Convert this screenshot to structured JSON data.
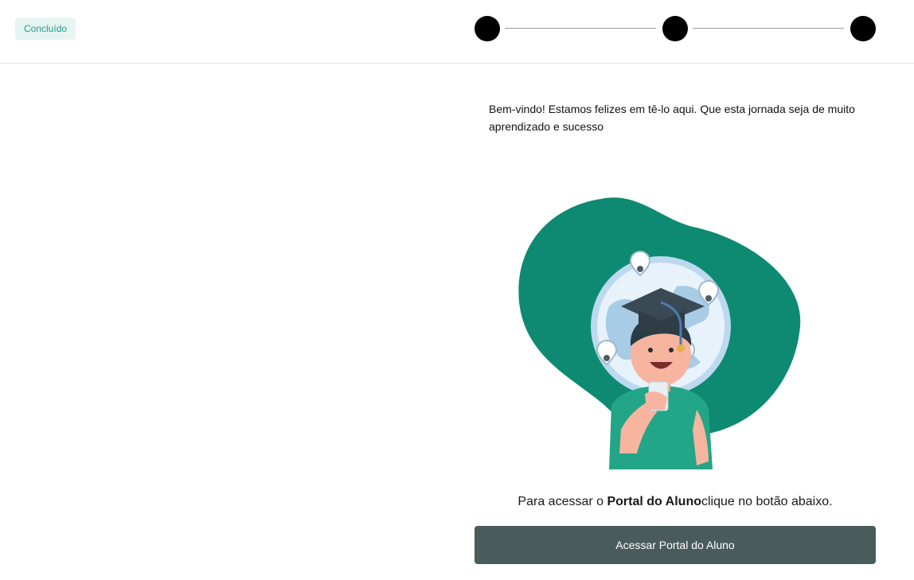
{
  "header": {
    "status_badge": "Concluído",
    "stepper": {
      "steps": 3
    }
  },
  "main": {
    "welcome_text": "Bem-vindo! Estamos felizes em tê-lo aqui. Que esta jornada seja de muito aprendizado e sucesso",
    "illustration_icon": "graduate-student-illustration",
    "cta_prefix": "Para acessar o ",
    "cta_bold": "Portal do Aluno",
    "cta_suffix": "clique no botão abaixo.",
    "button_label": "Acessar Portal do Aluno"
  },
  "colors": {
    "accent": "#0e8a72",
    "badge_bg": "#e6f4f2",
    "badge_text": "#1f9d8a",
    "button_bg": "#4a5b5c"
  }
}
